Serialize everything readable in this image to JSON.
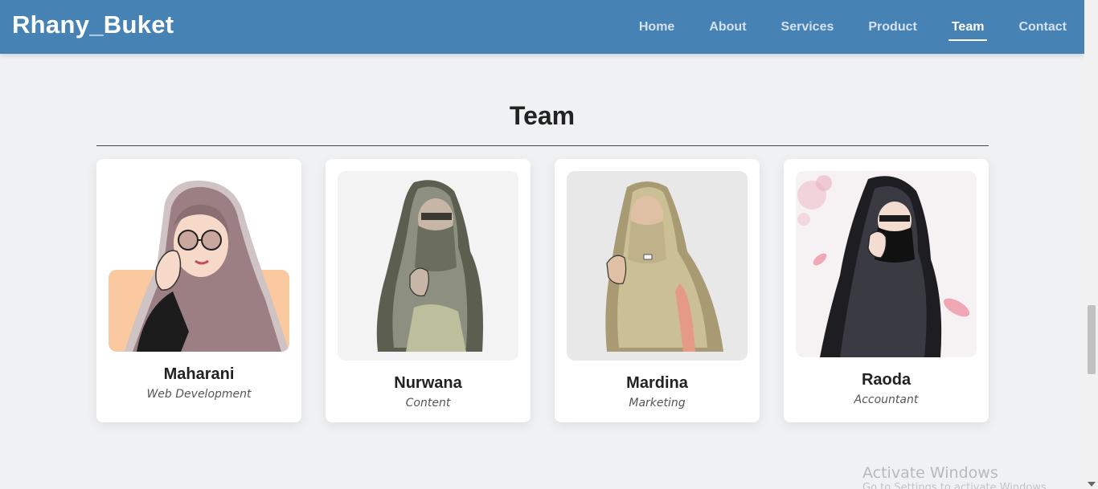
{
  "header": {
    "brand": "Rhany_Buket",
    "nav": [
      {
        "label": "Home",
        "active": false
      },
      {
        "label": "About",
        "active": false
      },
      {
        "label": "Services",
        "active": false
      },
      {
        "label": "Product",
        "active": false
      },
      {
        "label": "Team",
        "active": true
      },
      {
        "label": "Contact",
        "active": false
      }
    ]
  },
  "team": {
    "title": "Team",
    "members": [
      {
        "name": "Maharani",
        "role": "Web Development"
      },
      {
        "name": "Nurwana",
        "role": "Content"
      },
      {
        "name": "Mardina",
        "role": "Marketing"
      },
      {
        "name": "Raoda",
        "role": "Accountant"
      }
    ]
  },
  "overlay": {
    "watermark": "Activate Windows",
    "watermark_sub": "Go to Settings to activate Windows."
  },
  "colors": {
    "navbar": "#4682b4",
    "page_background": "#f0f1f3",
    "card_background": "#ffffff"
  }
}
